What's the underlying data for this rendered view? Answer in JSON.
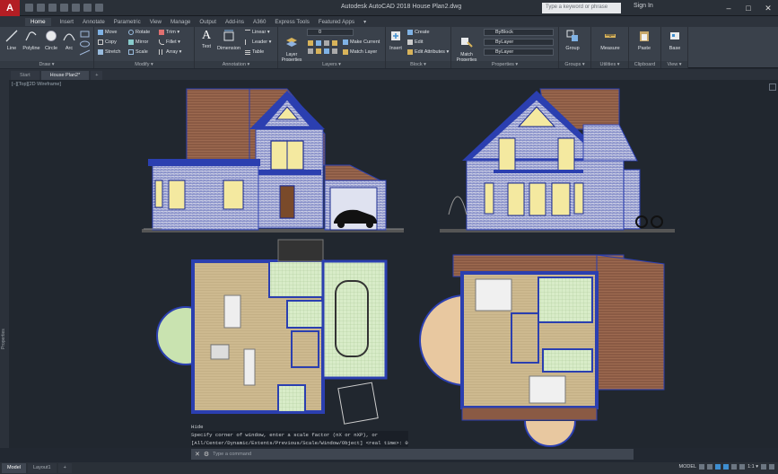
{
  "app": {
    "logo": "A",
    "title": "Autodesk AutoCAD 2018  House Plan2.dwg",
    "search_placeholder": "Type a keyword or phrase",
    "signin": "Sign In",
    "win_min": "–",
    "win_max": "□",
    "win_close": "✕"
  },
  "ribbon_tabs": [
    "Home",
    "Insert",
    "Annotate",
    "Parametric",
    "View",
    "Manage",
    "Output",
    "Add-ins",
    "A360",
    "Express Tools",
    "Featured Apps",
    "▾"
  ],
  "panels": {
    "draw": {
      "title": "Draw ▾",
      "line": "Line",
      "polyline": "Polyline",
      "circle": "Circle",
      "arc": "Arc"
    },
    "modify": {
      "title": "Modify ▾",
      "move": "Move",
      "rotate": "Rotate",
      "trim": "Trim ▾",
      "copy": "Copy",
      "mirror": "Mirror",
      "fillet": "Fillet ▾",
      "stretch": "Stretch",
      "scale": "Scale",
      "array": "Array ▾"
    },
    "annotation": {
      "title": "Annotation ▾",
      "text": "Text",
      "dimension": "Dimension",
      "linear": "Linear ▾",
      "leader": "Leader ▾",
      "table": "Table"
    },
    "layers": {
      "title": "Layers ▾",
      "layer_properties": "Layer Properties",
      "current_layer": "0",
      "make_current": "Make Current",
      "match_layer": "Match Layer"
    },
    "block": {
      "title": "Block ▾",
      "insert": "Insert",
      "create": "Create",
      "edit": "Edit",
      "edit_attributes": "Edit Attributes ▾"
    },
    "properties": {
      "title": "Properties ▾",
      "match_properties": "Match Properties",
      "color": "ByBlock",
      "linetype": "ByLayer",
      "lineweight": "ByLayer"
    },
    "groups": {
      "title": "Groups ▾",
      "group": "Group"
    },
    "utilities": {
      "title": "Utilities ▾",
      "measure": "Measure"
    },
    "clipboard": {
      "title": "Clipboard",
      "paste": "Paste"
    },
    "view": {
      "title": "View ▾",
      "base": "Base"
    }
  },
  "doc_tabs": [
    "Start",
    "House Plan2*",
    "+"
  ],
  "viewport_label": "[–][Top][2D Wireframe]",
  "side_palette": "Properties",
  "command_history": [
    "Hide",
    "Specify corner of window, enter a scale factor (nX or nXP), or",
    "[All/Center/Dynamic/Extents/Previous/Scale/Window/Object] <real time>: 0"
  ],
  "command_prompt": "Type a command",
  "status_tabs": [
    "Model",
    "Layout1",
    "+"
  ],
  "status_right": {
    "model": "MODEL",
    "scale": "1:1 ▾"
  },
  "colors": {
    "accent": "#b31e24",
    "roof": "#8a5a44",
    "wall": "#2b3fb0",
    "window": "#f4e9a0",
    "floor": "#c8b58a",
    "grass": "#c9e3b0"
  }
}
